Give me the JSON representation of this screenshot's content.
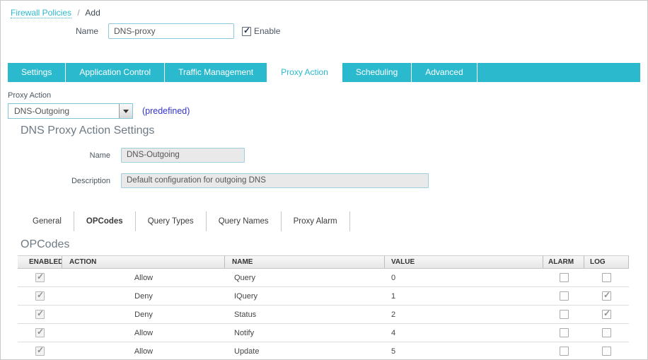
{
  "colors": {
    "accent_teal": "#2bb9ce",
    "heading_gray": "#6e7a84",
    "note_blue": "#3333cc"
  },
  "breadcrumb": {
    "link_label": "Firewall Policies",
    "separator": "/",
    "current": "Add"
  },
  "policy_header": {
    "name_label": "Name",
    "name_value": "DNS-proxy",
    "enable_label": "Enable",
    "enable_checked": true
  },
  "tabs": [
    {
      "label": "Settings",
      "active": false
    },
    {
      "label": "Application Control",
      "active": false
    },
    {
      "label": "Traffic Management",
      "active": false
    },
    {
      "label": "Proxy Action",
      "active": true
    },
    {
      "label": "Scheduling",
      "active": false
    },
    {
      "label": "Advanced",
      "active": false
    }
  ],
  "proxy_action": {
    "label": "Proxy Action",
    "selected_value": "DNS-Outgoing",
    "note": "(predefined)"
  },
  "settings": {
    "title": "DNS Proxy Action Settings",
    "name_label": "Name",
    "name_value": "DNS-Outgoing",
    "description_label": "Description",
    "description_value": "Default configuration for outgoing DNS"
  },
  "subtabs": [
    {
      "label": "General",
      "active": false
    },
    {
      "label": "OPCodes",
      "active": true
    },
    {
      "label": "Query Types",
      "active": false
    },
    {
      "label": "Query Names",
      "active": false
    },
    {
      "label": "Proxy Alarm",
      "active": false
    }
  ],
  "opcodes": {
    "title": "OPCodes",
    "columns": [
      "ENABLED",
      "ACTION",
      "NAME",
      "VALUE",
      "ALARM",
      "LOG"
    ],
    "rows": [
      {
        "enabled": true,
        "action": "Allow",
        "name": "Query",
        "value": "0",
        "alarm": false,
        "log": false
      },
      {
        "enabled": true,
        "action": "Deny",
        "name": "IQuery",
        "value": "1",
        "alarm": false,
        "log": true
      },
      {
        "enabled": true,
        "action": "Deny",
        "name": "Status",
        "value": "2",
        "alarm": false,
        "log": true
      },
      {
        "enabled": true,
        "action": "Allow",
        "name": "Notify",
        "value": "4",
        "alarm": false,
        "log": false
      },
      {
        "enabled": true,
        "action": "Allow",
        "name": "Update",
        "value": "5",
        "alarm": false,
        "log": false
      }
    ]
  }
}
